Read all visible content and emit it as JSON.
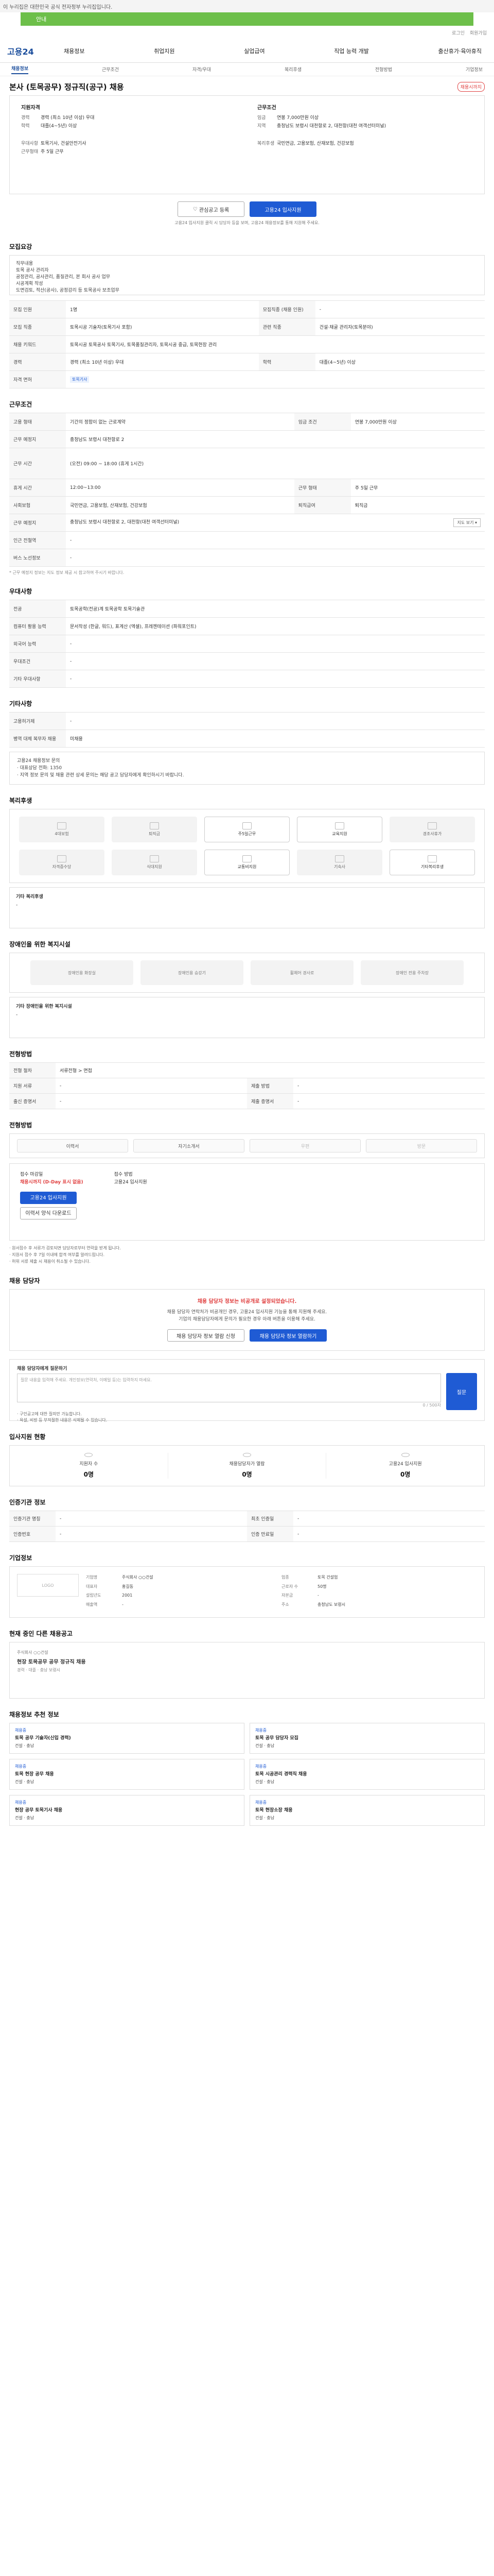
{
  "topbar": {
    "text": "이 누리집은 대한민국 공식 전자정부 누리집입니다."
  },
  "banner": {
    "text": "안내"
  },
  "util": {
    "links": [
      "로그인",
      "회원가입"
    ]
  },
  "gnb": {
    "logo": "고용24",
    "menu": [
      "채용정보",
      "취업지원",
      "실업급여",
      "직업 능력 개발",
      "출산휴가·육아휴직"
    ]
  },
  "tabs": {
    "items": [
      "채용정보",
      "근무조건",
      "자격/우대",
      "복리후생",
      "전형방법",
      "기업정보"
    ]
  },
  "job": {
    "title": "본사 (토목공무) 정규직(공구) 채용",
    "badge": "채용시까지",
    "summary_left_head": "지원자격",
    "summary_left": [
      [
        "경력",
        "경력 (최소 10년 이상) 우대"
      ],
      [
        "학력",
        "대졸(4~5년) 이상"
      ],
      [
        "우대사항",
        "토목기사, 건설안전기사"
      ],
      [
        "근무형태",
        "주 5일 근무"
      ]
    ],
    "summary_right_head": "근무조건",
    "summary_right": [
      [
        "임금",
        "연봉 7,000만원 이상"
      ],
      [
        "지역",
        "충청남도 보령시 대천항로 2, 대천항(대천 여객선터미널)"
      ],
      [
        "복리후생",
        "국민연금, 고용보험, 산재보험, 건강보험"
      ]
    ],
    "btn_scrap": "관심공고 등록",
    "btn_apply": "고용24 입사지원",
    "note": "고용24 입사지원 클릭 시 담당자 등을 보며, 고용24 채용정보를 통해 지원해 주세요."
  },
  "sections": {
    "recruit_title": "모집요강",
    "recruit_desc": "직무내용\n토목 공사 관리자\n공정관리, 공사관리, 품질관리, 본 회사 공사 업무\n시공계획 작성\n도면검토, 적산(공사), 공정감리 등 토목공사 보조업무",
    "recruit_rows": [
      [
        "모집 인원",
        "1명",
        "모집직종 (채용 인원)",
        "-"
      ],
      [
        "모집 직종",
        "토목시공 기술자(토목기사 포함)",
        "관련 직종",
        "건설·채굴 관리자(토목분야)"
      ],
      [
        "채용 키워드",
        "토목시공 토목공사 토목기사, 토목품질관리자, 토목시공 중급, 토목현장 관리",
        "",
        ""
      ],
      [
        "경력",
        "경력 (최소 10년 이상) 우대",
        "학력",
        "대졸(4~5년) 이상"
      ],
      [
        "자격 면허",
        "토목기사",
        "",
        ""
      ]
    ],
    "work_title": "근무조건",
    "work_rows": [
      [
        "고용 형태",
        "기간의 정함이 없는 근로계약",
        "임금 조건",
        "연봉 7,000만원 이상"
      ],
      [
        "근무 예정지",
        "충청남도 보령시 대천항로 2",
        "",
        ""
      ],
      [
        "근무 시간",
        "(오전) 09:00 ~ 18:00 (휴게 1시간)",
        "",
        ""
      ],
      [
        "휴게 시간",
        "12:00~13:00",
        "근무 형태",
        "주 5일 근무"
      ],
      [
        "사회보험",
        "국민연금, 고용보험, 산재보험, 건강보험",
        "퇴직급여",
        "퇴직금"
      ],
      [
        "근무 예정지",
        "충청남도 보령시 대천항로 2, 대천항(대천 여객선터미널)",
        "",
        ""
      ],
      [
        "인근 전철역",
        "-",
        "",
        ""
      ],
      [
        "버스 노선정보",
        "-",
        "",
        ""
      ]
    ],
    "work_note": "* 근무 예정지 정보는 지도 정보 제공 시 참고하여 주시기 바랍니다.",
    "pref_title": "우대사항",
    "pref_rows": [
      [
        "전공",
        "토목공학(전공)계 토목공학 토목기술관"
      ],
      [
        "컴퓨터 활용 능력",
        "문서작성 (한글, 워드), 표계산 (엑셀), 프레젠테이션 (파워포인트)"
      ],
      [
        "외국어 능력",
        "-"
      ],
      [
        "우대조건",
        "-"
      ],
      [
        "기타 우대사항",
        "-"
      ]
    ],
    "other_title": "기타사항",
    "other_rows": [
      [
        "고용허가제",
        "-"
      ],
      [
        "병역 대체 복무자 채용",
        "미채용"
      ]
    ],
    "contact_box": "고용24 채용정보 문의\n· 대표상담 전화: 1350\n· 지역 정보 문의 및 채용 관련 상세 문의는 해당 공고 담당자에게 확인하시기 바랍니다.",
    "welfare_title": "복리후생",
    "welfare_items": [
      "4대보험",
      "퇴직금",
      "주5일근무",
      "교육지원",
      "경조사휴가",
      "자격증수당",
      "식대지원",
      "교통비지원",
      "기숙사",
      "기타복리후생"
    ],
    "welfare_etc_title": "기타 복리후생",
    "welfare_etc": "-",
    "disab_title": "장애인을 위한 복지시설",
    "disab_items": [
      "장애인용 화장실",
      "장애인용 승강기",
      "휠체어 경사로",
      "장애인 전용 주차장"
    ],
    "disab_etc_title": "기타 장애인을 위한 복지시설",
    "disab_etc": "-",
    "process_title": "전형방법",
    "process_rows": [
      [
        "전형 절차",
        "서류전형 > 면접",
        "",
        ""
      ],
      [
        "지원 서류",
        "-",
        "제출 방법",
        "-"
      ],
      [
        "출신 증명서",
        "-",
        "제출 증명서",
        "-"
      ]
    ],
    "method_title": "전형방법",
    "methods": [
      "이력서",
      "자기소개서",
      "우편",
      "방문"
    ],
    "apply_deadline_label": "접수 마감일",
    "apply_deadline": "채용시까지 (D-Day 표시 없음)",
    "apply_method_label": "접수 방법",
    "apply_method": "고용24 입사지원",
    "apply_btn": "고용24 입사지원",
    "apply_btn2": "이력서 양식 다운로드",
    "apply_bullets": "· 원서접수 후 서류가 검토되면 담당자로부터 연락을 받게 됩니다.\n· 지원서 접수 후 7일 이내에 합격 여부를 알려드립니다.\n· 허위 서류 제출 시 채용이 취소될 수 있습니다.",
    "manager_title": "채용 담당자",
    "manager_msg": "채용 담당자 정보는 비공개로 설정되었습니다.",
    "manager_sub": "채용 담당자 연락처가 비공개인 경우, 고용24 입사지원 기능을 통해 지원해 주세요.\n기업의 채용담당자에게 문의가 필요한 경우 아래 버튼을 이용해 주세요.",
    "manager_btn1": "채용 담당자 정보 열람 신청",
    "manager_btn2": "채용 담당자 정보 열람하기",
    "inquiry_title": "채용 담당자에게 질문하기",
    "inquiry_placeholder": "질문 내용을 입력해 주세요. 개인정보(연락처, 이메일 등)는 입력하지 마세요.",
    "inquiry_btn": "질문",
    "inquiry_count": "0 / 500자",
    "inquiry_notes": "· 구인공고에 대한 질의만 가능합니다.\n· 욕설, 비방 등 부적절한 내용은 삭제될 수 있습니다.",
    "status_title": "입사지원 현황",
    "status_items": [
      [
        "지원자 수",
        "0명"
      ],
      [
        "채용담당자가 열람",
        "0명"
      ],
      [
        "고용24 입사지원",
        "0명"
      ]
    ],
    "related_title": "인증기관 정보",
    "related_rows": [
      [
        "인증기관 명칭",
        "-",
        "최초 인증일",
        "-"
      ],
      [
        "인증번호",
        "-",
        "인증 만료일",
        "-"
      ]
    ],
    "company_title": "기업정보",
    "company_logo": "LOGO",
    "company_fields": [
      [
        "기업명",
        "주식회사 ○○건설"
      ],
      [
        "업종",
        "토목 건설업"
      ],
      [
        "대표자",
        "홍길동"
      ],
      [
        "근로자 수",
        "50명"
      ],
      [
        "설립년도",
        "2001"
      ],
      [
        "자본금",
        "-"
      ],
      [
        "매출액",
        "-"
      ],
      [
        "주소",
        "충청남도 보령시"
      ]
    ],
    "more_title": "현재 중인 다른 채용공고",
    "more_label": "주식회사 ○○건설",
    "more_job": "현장 토목공무 공무 정규직 채용",
    "more_meta": "경력 · 대졸 · 충남 보령시",
    "rec_title": "채용정보 추천 정보",
    "rec_items": [
      [
        "채용중",
        "토목 공무 기술자(신입 경력)",
        "건설 · 충남"
      ],
      [
        "채용중",
        "토목 공무 담당자 모집",
        "건설 · 충남"
      ],
      [
        "채용중",
        "토목 현장 공무 채용",
        "건설 · 충남"
      ],
      [
        "채용중",
        "토목 시공관리 경력직 채용",
        "건설 · 충남"
      ],
      [
        "채용중",
        "현장 공무 토목기사 채용",
        "건설 · 충남"
      ],
      [
        "채용중",
        "토목 현장소장 채용",
        "건설 · 충남"
      ]
    ]
  }
}
